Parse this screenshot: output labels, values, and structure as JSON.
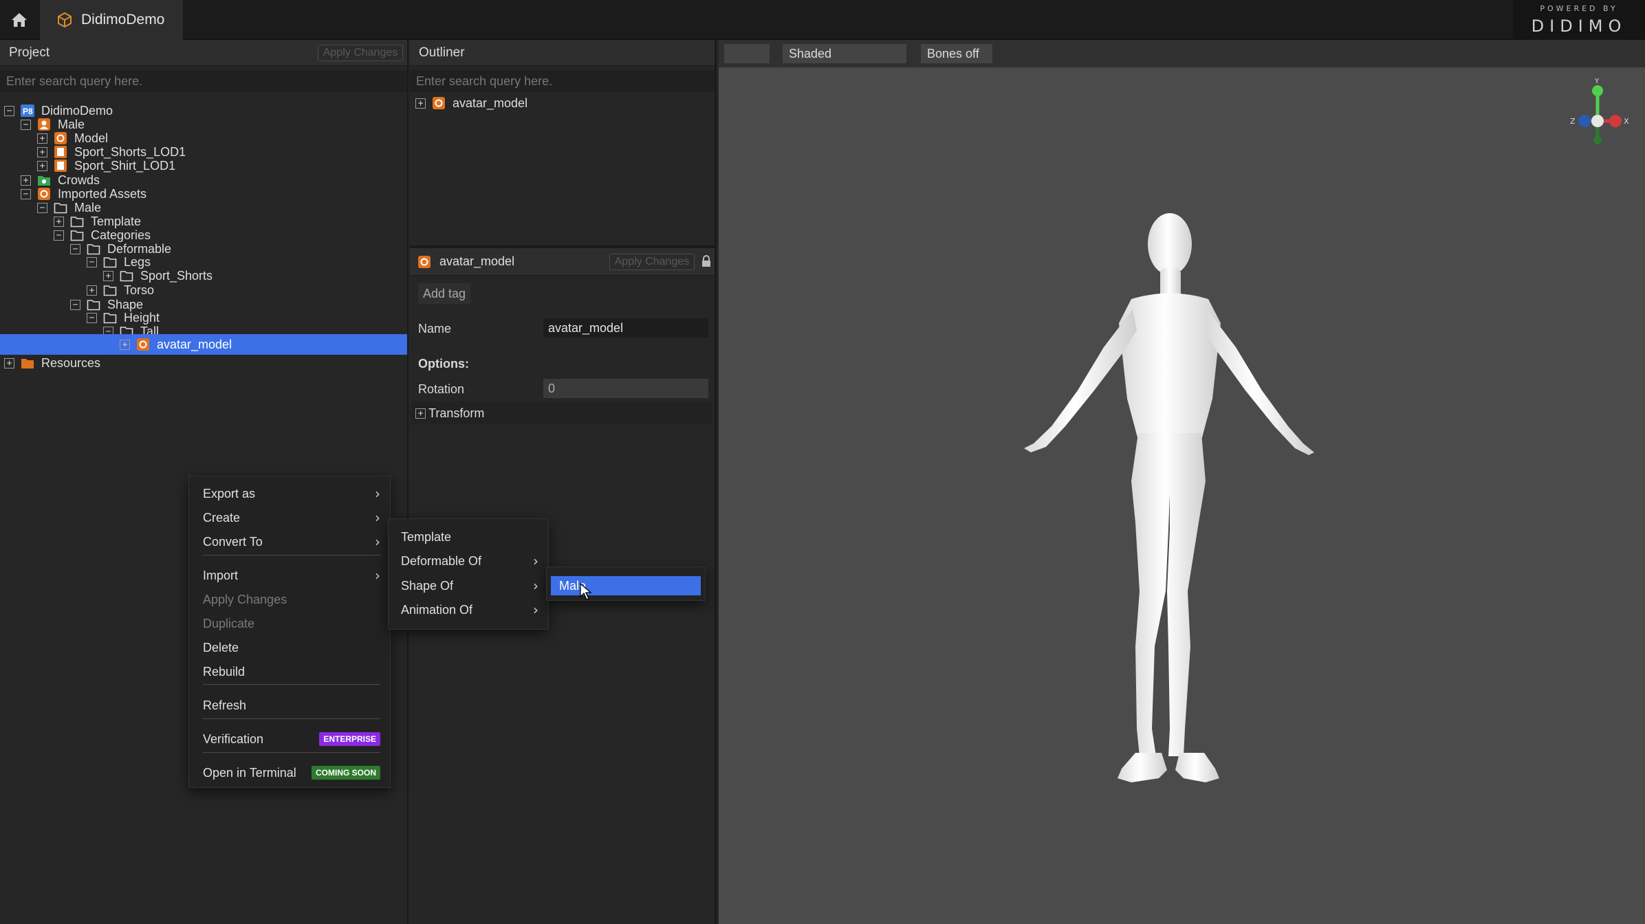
{
  "app": {
    "tab_title": "DidimoDemo",
    "powered_by": "POWERED BY",
    "logo_text": "DIDIMO"
  },
  "project": {
    "title": "Project",
    "apply_label": "Apply Changes",
    "search_placeholder": "Enter search query here.",
    "tree": [
      {
        "label": "DidimoDemo",
        "icon": "project-badge-icon",
        "expander": "−"
      },
      {
        "label": "Male",
        "icon": "character-icon",
        "expander": "−"
      },
      {
        "label": "Model",
        "icon": "model-icon",
        "expander": "+"
      },
      {
        "label": "Sport_Shorts_LOD1",
        "icon": "garment-icon",
        "expander": "+"
      },
      {
        "label": "Sport_Shirt_LOD1",
        "icon": "garment-icon",
        "expander": "+"
      },
      {
        "label": "Crowds",
        "icon": "crowds-folder-icon",
        "expander": "+"
      },
      {
        "label": "Imported Assets",
        "icon": "imported-assets-icon",
        "expander": "−"
      },
      {
        "label": "Male",
        "icon": "folder-icon",
        "expander": "−"
      },
      {
        "label": "Template",
        "icon": "folder-icon",
        "expander": "+"
      },
      {
        "label": "Categories",
        "icon": "folder-icon",
        "expander": "−"
      },
      {
        "label": "Deformable",
        "icon": "folder-icon",
        "expander": "−"
      },
      {
        "label": "Legs",
        "icon": "folder-icon",
        "expander": "−"
      },
      {
        "label": "Sport_Shorts",
        "icon": "folder-icon",
        "expander": "+"
      },
      {
        "label": "Torso",
        "icon": "folder-icon",
        "expander": "+"
      },
      {
        "label": "Shape",
        "icon": "folder-icon",
        "expander": "−"
      },
      {
        "label": "Height",
        "icon": "folder-icon",
        "expander": "−"
      },
      {
        "label": "Tall",
        "icon": "folder-icon",
        "expander": "−"
      },
      {
        "label": "avatar_model",
        "icon": "model-icon",
        "expander": "+",
        "selected": true
      },
      {
        "label": "Resources",
        "icon": "resources-folder-icon",
        "expander": "+"
      }
    ]
  },
  "outliner": {
    "title": "Outliner",
    "search_placeholder": "Enter search query here.",
    "item_label": "avatar_model",
    "expander": "+"
  },
  "properties": {
    "title": "avatar_model",
    "apply_label": "Apply Changes",
    "add_tag": "Add tag",
    "name_label": "Name",
    "name_value": "avatar_model",
    "options_label": "Options:",
    "rotation_label": "Rotation",
    "rotation_value": "0",
    "transform_label": "Transform",
    "transform_expander": "+"
  },
  "viewport": {
    "mode_value": "",
    "shading_label": "Shaded",
    "bones_label": "Bones off",
    "gizmo": {
      "y": "Y",
      "x": "X",
      "z": "Z"
    },
    "colors": {
      "y_axis": "#4fd14f",
      "x_axis": "#d23b3b",
      "z_axis": "#3b6fd2",
      "background": "#4b4b4b"
    }
  },
  "context_menu": {
    "items": [
      {
        "label": "Export as",
        "submenu": true
      },
      {
        "label": "Create",
        "submenu": true
      },
      {
        "label": "Convert To",
        "submenu": true
      },
      {
        "label": "Import",
        "submenu": true
      },
      {
        "label": "Apply Changes",
        "disabled": true
      },
      {
        "label": "Duplicate",
        "disabled": true
      },
      {
        "label": "Delete"
      },
      {
        "label": "Rebuild"
      },
      {
        "label": "Refresh"
      },
      {
        "label": "Verification",
        "badge": "ENTERPRISE",
        "badge_color": "#8a2be2"
      },
      {
        "label": "Open in Terminal",
        "badge": "COMING SOON",
        "badge_color": "#2f7a2f"
      }
    ],
    "chevron": "›"
  },
  "convert_menu": {
    "items": [
      {
        "label": "Template"
      },
      {
        "label": "Deformable Of",
        "submenu": true
      },
      {
        "label": "Shape Of",
        "submenu": true
      },
      {
        "label": "Animation Of",
        "submenu": true
      }
    ]
  },
  "shape_menu": {
    "items": [
      {
        "label": "Male",
        "highlighted": true
      }
    ],
    "highlight_color": "#3d6fe6"
  }
}
